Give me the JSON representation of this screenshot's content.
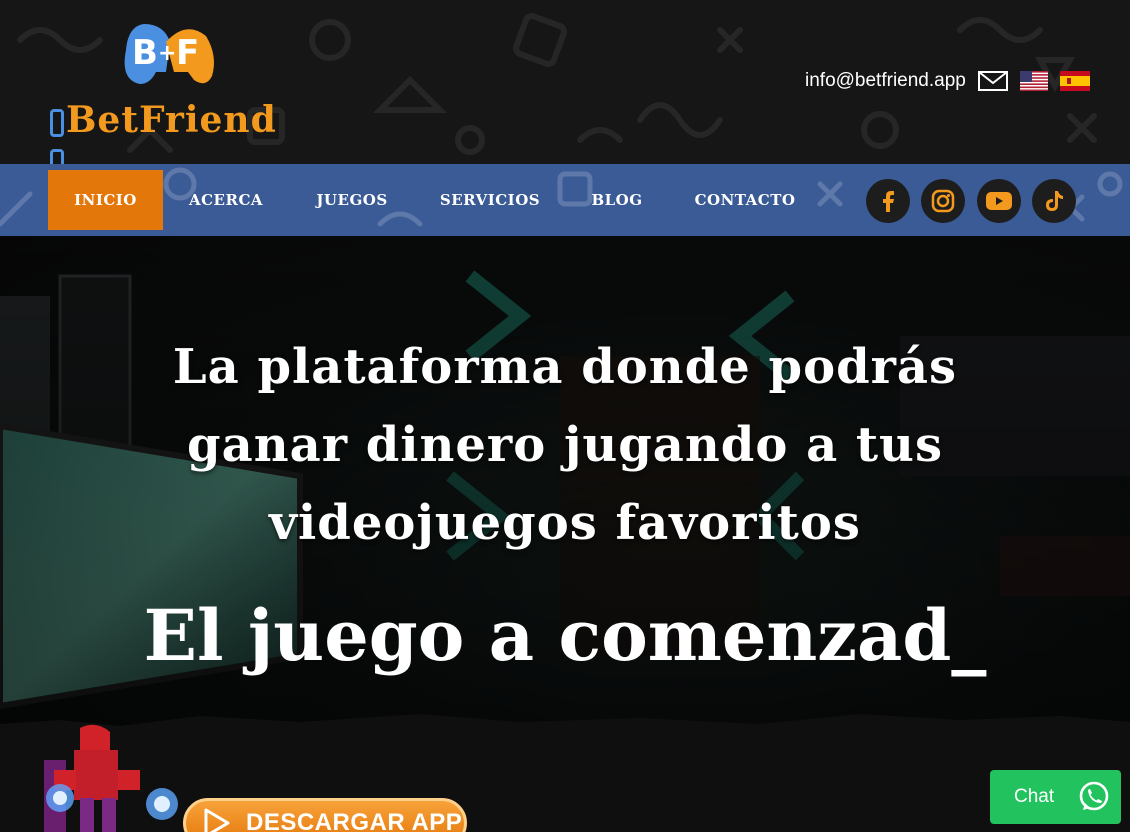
{
  "header": {
    "logo_text": "BetFriend",
    "email": "info@betfriend.app",
    "flags": [
      "us-flag",
      "es-flag"
    ]
  },
  "nav": {
    "items": [
      {
        "label": "INICIO",
        "active": true
      },
      {
        "label": "ACERCA",
        "active": false
      },
      {
        "label": "JUEGOS",
        "active": false
      },
      {
        "label": "SERVICIOS",
        "active": false
      },
      {
        "label": "BLOG",
        "active": false
      },
      {
        "label": "CONTACTO",
        "active": false
      }
    ],
    "social": [
      "facebook-icon",
      "instagram-icon",
      "youtube-icon",
      "tiktok-icon"
    ]
  },
  "hero": {
    "headline": "La plataforma donde podrás ganar dinero jugando a tus videojuegos favoritos",
    "typewriter": "El juego a comenzad_",
    "download_label": "DESCARGAR APP"
  },
  "chat": {
    "label": "Chat"
  },
  "colors": {
    "accent": "#e4770a",
    "nav_bg": "#3b5b96",
    "logo_orange": "#f39a1e",
    "logo_blue": "#4a8fe0",
    "whatsapp": "#22c35e"
  }
}
